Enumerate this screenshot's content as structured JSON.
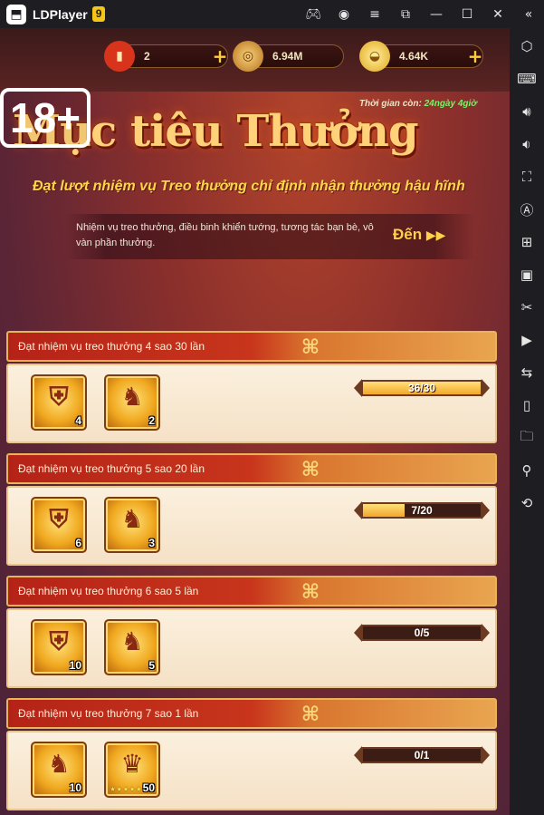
{
  "window": {
    "app_name": "LDPlayer",
    "version": "9",
    "controls": [
      "gamepad-icon",
      "account-icon",
      "menu-icon",
      "restore-icon",
      "minimize-icon",
      "maximize-icon",
      "close-icon",
      "collapse-sidebar-icon"
    ]
  },
  "sidebar": {
    "items": [
      "settings-icon",
      "keyboard-icon",
      "volume-up-icon",
      "volume-down-icon",
      "fullscreen-icon",
      "auto-click-icon",
      "multi-instance-icon",
      "apk-icon",
      "screenshot-scissors-icon",
      "record-icon",
      "sync-icon",
      "shake-icon",
      "folder-icon",
      "location-icon",
      "rotate-icon"
    ]
  },
  "resources": {
    "tickets": "2",
    "coins": "6.94M",
    "ingots": "4.64K"
  },
  "event": {
    "badge": "18+",
    "timer_label": "Thời gian còn:",
    "timer_value": "24ngày 4giờ",
    "title": "Mục tiêu Thưởng",
    "subtitle": "Đạt lượt nhiệm vụ Treo thưởng chỉ định nhận thưởng hậu hĩnh",
    "description": "Nhiệm vụ treo thưởng, điều binh khiển tướng, tương tác bạn bè, vô vàn phần thưởng.",
    "go_label": "Đến"
  },
  "tasks": [
    {
      "label": "Đạt nhiệm vụ treo thưởng 4 sao 30 lần",
      "progress_text": "36/30",
      "progress": 1.0,
      "rewards": [
        {
          "icon": "shield-reward-icon",
          "count": "4"
        },
        {
          "icon": "lion-statue-reward-icon",
          "count": "2"
        }
      ]
    },
    {
      "label": "Đạt nhiệm vụ treo thưởng 5 sao 20 lần",
      "progress_text": "7/20",
      "progress": 0.35,
      "rewards": [
        {
          "icon": "shield-reward-icon",
          "count": "6"
        },
        {
          "icon": "lion-statue-reward-icon",
          "count": "3"
        }
      ]
    },
    {
      "label": "Đạt nhiệm vụ treo thưởng 6 sao 5 lần",
      "progress_text": "0/5",
      "progress": 0.0,
      "rewards": [
        {
          "icon": "shield-reward-icon",
          "count": "10"
        },
        {
          "icon": "lion-statue-reward-icon",
          "count": "5"
        }
      ]
    },
    {
      "label": "Đạt nhiệm vụ treo thưởng 7 sao 1 lần",
      "progress_text": "0/1",
      "progress": 0.0,
      "rewards": [
        {
          "icon": "lion-statue-reward-icon",
          "count": "10"
        },
        {
          "icon": "hero-helmet-reward-icon",
          "count": "50",
          "stars": "★★★★★"
        }
      ]
    }
  ],
  "colors": {
    "accent_gold": "#ffd04a",
    "header_red": "#c8351c",
    "progress_green": "#7df06b"
  }
}
